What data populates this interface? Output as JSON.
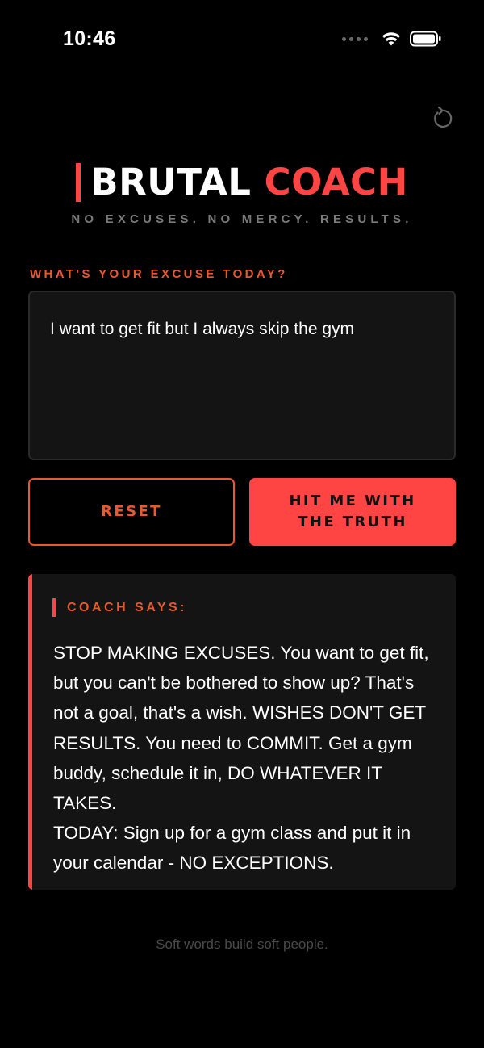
{
  "status_bar": {
    "time": "10:46",
    "icons": [
      "cellular-signal-icon",
      "wifi-icon",
      "battery-icon"
    ]
  },
  "header": {
    "refresh_icon": "refresh-icon",
    "title_part1": "BRUTAL",
    "title_part2": "COACH",
    "tagline": "NO EXCUSES. NO MERCY. RESULTS."
  },
  "excuse": {
    "label": "WHAT'S YOUR EXCUSE TODAY?",
    "value": "I want to get fit but I always skip the gym"
  },
  "buttons": {
    "reset_label": "RESET",
    "truth_line1": "HIT ME WITH",
    "truth_line2": "THE TRUTH"
  },
  "coach": {
    "label": "COACH SAYS:",
    "message": "STOP MAKING EXCUSES. You want to get fit, but you can't be bothered to show up? That's not a goal, that's a wish. WISHES DON'T GET RESULTS. You need to COMMIT. Get a gym buddy, schedule it in, DO WHATEVER IT TAKES.",
    "action": "TODAY: Sign up for a gym class and put it in your calendar - NO EXCEPTIONS."
  },
  "footer": {
    "text": "Soft words build soft people."
  },
  "colors": {
    "background": "#000000",
    "accent_red": "#ff4444",
    "accent_orange": "#e85a2e",
    "card": "#141414",
    "muted": "#7a7a7a"
  }
}
